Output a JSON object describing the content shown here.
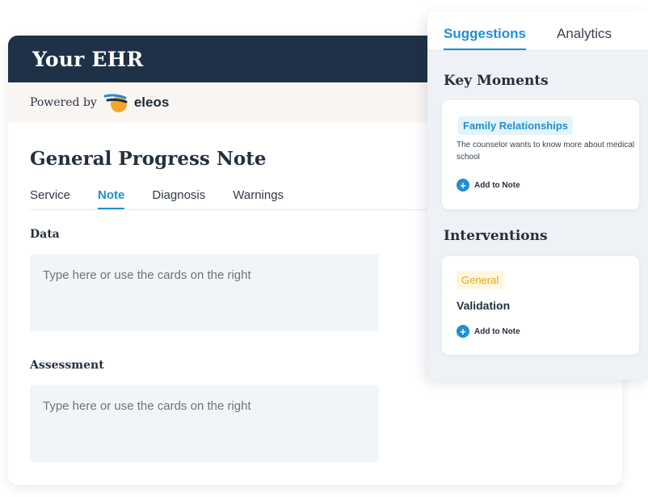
{
  "ehr": {
    "title": "Your EHR",
    "powered_by": "Powered by",
    "brand_name": "eleos",
    "note_title": "General Progress Note",
    "tabs": [
      {
        "label": "Service",
        "active": false
      },
      {
        "label": "Note",
        "active": true
      },
      {
        "label": "Diagnosis",
        "active": false
      },
      {
        "label": "Warnings",
        "active": false
      }
    ],
    "sections": [
      {
        "label": "Data",
        "placeholder": "Type here or use the cards on the right"
      },
      {
        "label": "Assessment",
        "placeholder": "Type here or use the cards on the right"
      }
    ]
  },
  "panel": {
    "tabs": [
      {
        "label": "Suggestions",
        "active": true
      },
      {
        "label": "Analytics",
        "active": false
      }
    ],
    "key_moments": {
      "heading": "Key Moments",
      "card": {
        "tag": "Family Relationships",
        "description": "The counselor wants to know more about medical school",
        "action": "Add to Note"
      }
    },
    "interventions": {
      "heading": "Interventions",
      "card": {
        "tag": "General",
        "title": "Validation",
        "action": "Add to Note"
      }
    }
  },
  "colors": {
    "header_bg": "#1f3147",
    "accent": "#1f8fd6",
    "tag_yellow": "#e7a823",
    "field_bg": "#f2f5f8"
  },
  "icons": [
    "eleos-logo-icon",
    "plus-circle-icon"
  ]
}
